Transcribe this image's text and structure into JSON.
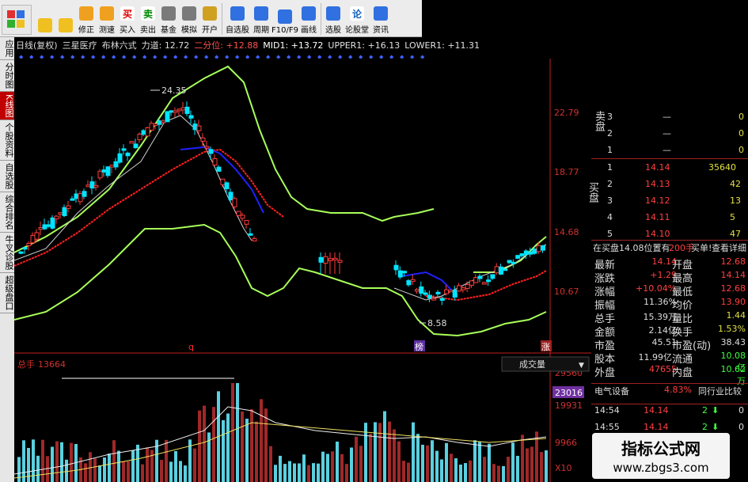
{
  "toolbar": {
    "buttons": [
      {
        "label": "",
        "icon": "back-arrow-icon"
      },
      {
        "label": "",
        "icon": "up-down-arrows-icon"
      },
      {
        "label": "修正",
        "icon": "refresh-circle-icon"
      },
      {
        "label": "测速",
        "icon": "clock-icon"
      },
      {
        "label": "买入",
        "icon": "buy-icon",
        "glyph": "买"
      },
      {
        "label": "卖出",
        "icon": "sell-icon",
        "glyph": "卖"
      },
      {
        "label": "基金",
        "icon": "gavel-icon"
      },
      {
        "label": "模拟",
        "icon": "fist-icon"
      },
      {
        "label": "开户",
        "icon": "lock-icon"
      },
      {
        "label": "自选股",
        "icon": "star-list-icon"
      },
      {
        "label": "周期",
        "icon": "cycle-icon"
      },
      {
        "label": "F10/F9",
        "icon": "f10-icon"
      },
      {
        "label": "画线",
        "icon": "pencil-icon"
      },
      {
        "label": "选股",
        "icon": "grid-icon"
      },
      {
        "label": "论股堂",
        "icon": "lun-icon",
        "glyph": "论"
      },
      {
        "label": "资讯",
        "icon": "news-icon"
      }
    ]
  },
  "side_tabs": [
    "应用",
    "分时图",
    "K线图",
    "个股资料",
    "自选股",
    "综合排名",
    "牛叉诊股",
    "超级盘口"
  ],
  "chart_header": {
    "period": "日线(复权)",
    "stock": "三星医疗",
    "indicator": "布林六式",
    "lidao_label": "力道:",
    "lidao": "12.72",
    "erfenwei_label": "二分位:",
    "erfenwei": "+12.88",
    "mid_label": "MID1:",
    "mid": "+13.72",
    "upper_label": "UPPER1:",
    "upper": "+16.13",
    "lower_label": "LOWER1:",
    "lower": "+11.31"
  },
  "price_axis": [
    "22.79",
    "18.77",
    "14.68",
    "10.67"
  ],
  "annotations": {
    "high": "24.35",
    "low": "8.58",
    "mark_q": "q",
    "mark_bang": "榜",
    "mark_zhang": "涨"
  },
  "volume": {
    "label": "总手",
    "value": "13664",
    "dropdown": "成交量",
    "axis": [
      "29560",
      "23016",
      "19931",
      "9966",
      "X10"
    ]
  },
  "colors": {
    "up": "#ff3c3c",
    "down": "#00e5ff",
    "upper_band": "#a8ff5a",
    "mid_red": "#ff2020",
    "blue_line": "#2020ff",
    "axis_text": "#d03030"
  },
  "order_book": {
    "sell_label": "卖盘",
    "buy_label": "买盘",
    "sell": [
      {
        "level": "3",
        "price": "—",
        "vol": "0"
      },
      {
        "level": "2",
        "price": "—",
        "vol": "0"
      },
      {
        "level": "1",
        "price": "—",
        "vol": "0"
      }
    ],
    "buy": [
      {
        "level": "1",
        "price": "14.14",
        "vol": "35640"
      },
      {
        "level": "2",
        "price": "14.13",
        "vol": "42"
      },
      {
        "level": "3",
        "price": "14.12",
        "vol": "13"
      },
      {
        "level": "4",
        "price": "14.11",
        "vol": "5"
      },
      {
        "level": "5",
        "price": "14.10",
        "vol": "47"
      }
    ]
  },
  "bid_info": {
    "text": "在买盘14.08位置有",
    "amount": "200手",
    "order": "买单!",
    "detail": "查看详细"
  },
  "quote": [
    {
      "l": "最新",
      "lv": "14.14",
      "r": "开盘",
      "rv": "12.68"
    },
    {
      "l": "涨跌",
      "lv": "+1.29",
      "r": "最高",
      "rv": "14.14"
    },
    {
      "l": "涨幅",
      "lv": "+10.04%",
      "r": "最低",
      "rv": "12.68"
    },
    {
      "l": "振幅",
      "lv": "11.36%",
      "r": "均价",
      "rv": "13.90"
    },
    {
      "l": "总手",
      "lv": "15.39万",
      "r": "量比",
      "rv": "1.44"
    },
    {
      "l": "金额",
      "lv": "2.14亿",
      "r": "换手",
      "rv": "1.53%"
    },
    {
      "l": "市盈",
      "lv": "45.51",
      "r": "市盈(动)",
      "rv": "38.43"
    },
    {
      "l": "股本",
      "lv": "11.99亿",
      "r": "流通",
      "rv": "10.08亿"
    },
    {
      "l": "外盘",
      "lv": "47655",
      "r": "内盘",
      "rv": "10.62万"
    }
  ],
  "sector": {
    "name": "电气设备",
    "change": "4.83%",
    "compare": "同行业比较"
  },
  "ticks": [
    {
      "time": "14:54",
      "price": "14.14",
      "vol": "2",
      "flag": "0"
    },
    {
      "time": "14:55",
      "price": "14.14",
      "vol": "2",
      "flag": "0"
    }
  ],
  "watermark": {
    "title": "指标公式网",
    "url": "www.zbgs3.com"
  }
}
